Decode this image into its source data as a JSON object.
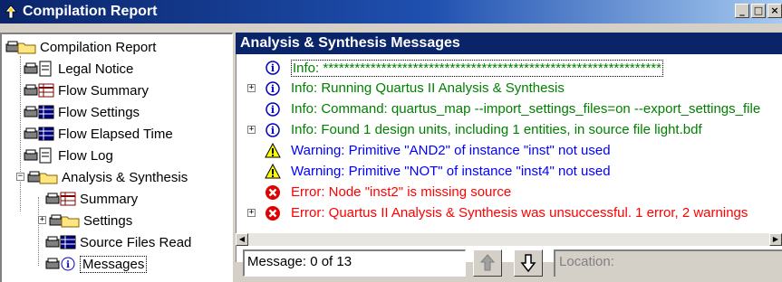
{
  "window": {
    "title": "Compilation Report",
    "buttons": [
      "_",
      "□",
      "×"
    ]
  },
  "tree": {
    "items": [
      {
        "label": "Compilation Report",
        "icon": "printer-folder-icon"
      },
      {
        "label": "Legal Notice",
        "icon": "printer-document-icon"
      },
      {
        "label": "Flow Summary",
        "icon": "printer-table-icon"
      },
      {
        "label": "Flow Settings",
        "icon": "printer-table-icon"
      },
      {
        "label": "Flow Elapsed Time",
        "icon": "printer-table-icon"
      },
      {
        "label": "Flow Log",
        "icon": "printer-document-icon"
      },
      {
        "label": "Analysis & Synthesis",
        "icon": "printer-folder-icon"
      },
      {
        "label": "Summary",
        "icon": "printer-table-icon"
      },
      {
        "label": "Settings",
        "icon": "printer-folder-icon"
      },
      {
        "label": "Source Files Read",
        "icon": "printer-table-icon"
      },
      {
        "label": "Messages",
        "icon": "printer-info-icon"
      }
    ]
  },
  "messages": {
    "header": "Analysis & Synthesis Messages",
    "rows": [
      {
        "text": "Info: ****************************************************************",
        "kind": "info",
        "expandable": false
      },
      {
        "text": "Info: Running Quartus II Analysis & Synthesis",
        "kind": "info",
        "expandable": true
      },
      {
        "text": "Info: Command: quartus_map --import_settings_files=on --export_settings_file",
        "kind": "info",
        "expandable": false
      },
      {
        "text": "Info: Found 1 design units, including 1 entities, in source file light.bdf",
        "kind": "info",
        "expandable": true
      },
      {
        "text": "Warning: Primitive \"AND2\" of instance \"inst\" not used",
        "kind": "warn",
        "expandable": false
      },
      {
        "text": "Warning: Primitive \"NOT\" of instance \"inst4\" not used",
        "kind": "warn",
        "expandable": false
      },
      {
        "text": "Error: Node \"inst2\" is missing source",
        "kind": "err",
        "expandable": false
      },
      {
        "text": "Error: Quartus II Analysis & Synthesis was unsuccessful. 1 error, 2 warnings",
        "kind": "err",
        "expandable": true
      }
    ]
  },
  "statusbar": {
    "message_count": "Message: 0 of 13",
    "location_placeholder": "Location:"
  },
  "colors": {
    "title_gradient_start": "#0a246a",
    "info": "#008000",
    "warning": "#0000ff",
    "error": "#ff0000"
  }
}
